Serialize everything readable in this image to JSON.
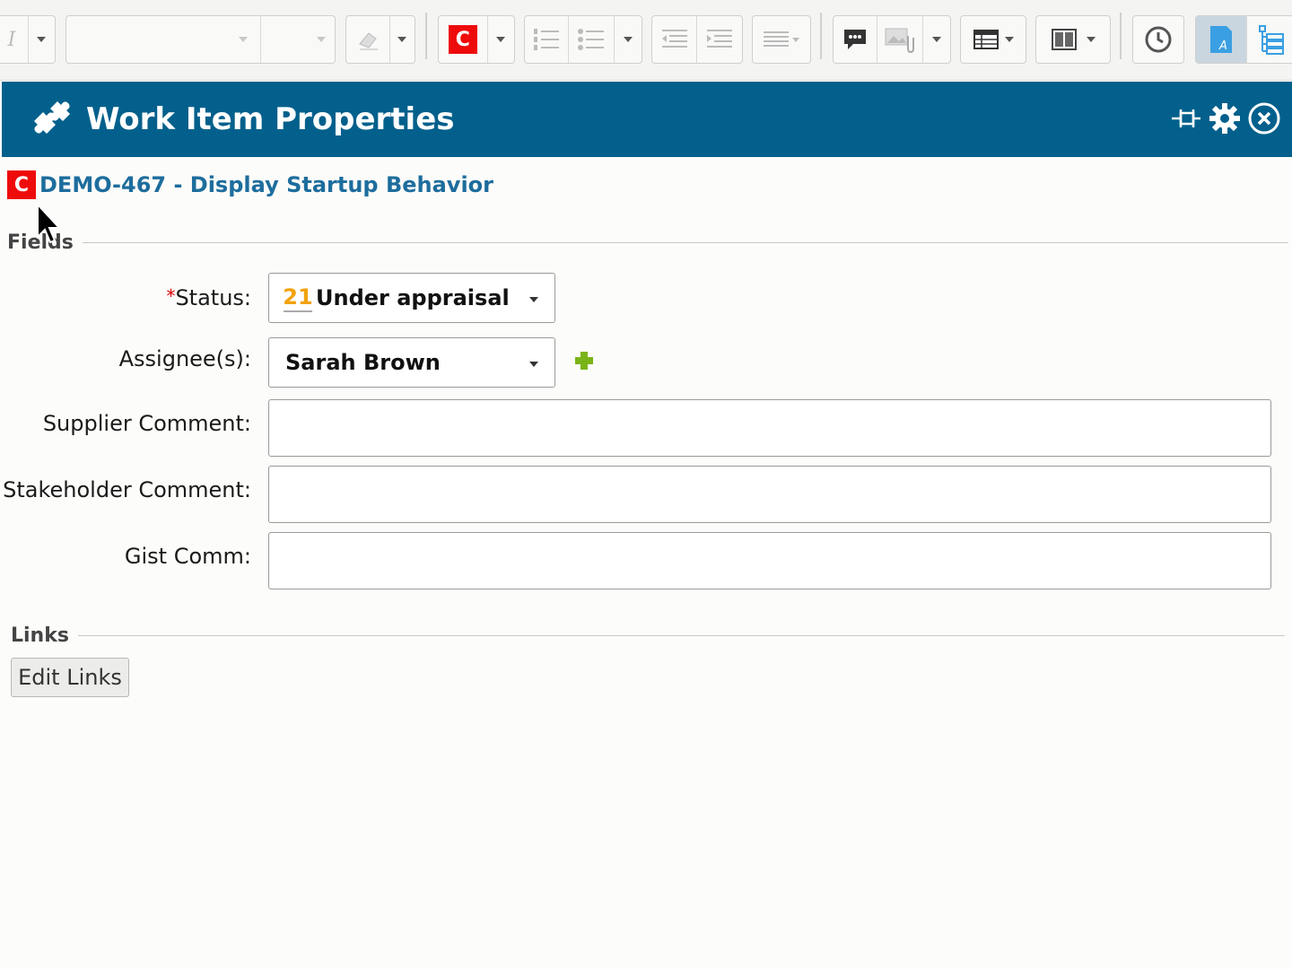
{
  "panel": {
    "title": "Work Item Properties"
  },
  "work_item": {
    "badge": "C",
    "link_text": "DEMO-467 - Display Startup Behavior"
  },
  "toolbar": {
    "italic_glyph": "I",
    "requirement_badge": "C"
  },
  "sections": {
    "fields": "Fields",
    "links": "Links"
  },
  "fields": {
    "status_required_marker": "*",
    "status_label": "Status:",
    "status_value": "Under appraisal",
    "status_icon_text": "21",
    "assignee_label": "Assignee(s):",
    "assignee_value": "Sarah Brown",
    "supplier_comment_label": "Supplier Comment:",
    "supplier_comment_value": "",
    "stakeholder_comment_label": "Stakeholder Comment:",
    "stakeholder_comment_value": "",
    "gist_comm_label": "Gist Comm:",
    "gist_comm_value": ""
  },
  "links": {
    "edit_button": "Edit Links"
  },
  "colors": {
    "header_bg": "#03608c",
    "link": "#1d6d9d",
    "badge_red": "#ee0b0b",
    "add_green": "#7ab317",
    "status_icon": "#f2a20c"
  }
}
